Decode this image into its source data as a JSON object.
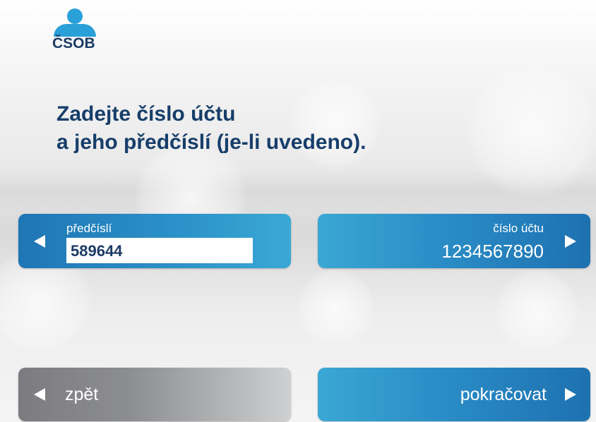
{
  "brand": {
    "logo_text": "ČSOB",
    "logo_color": "#2aa0d8",
    "text_color": "#1c3b64"
  },
  "title": {
    "line1": "Zadejte číslo účtu",
    "line2": "a jeho předčíslí (je-li uvedeno)."
  },
  "prefix_field": {
    "label": "předčíslí",
    "value": "589644",
    "arrow_icon": "triangle-left-icon"
  },
  "account_field": {
    "label": "číslo účtu",
    "value": "1234567890",
    "arrow_icon": "triangle-right-icon"
  },
  "buttons": {
    "back": {
      "label": "zpět",
      "icon": "triangle-left-icon"
    },
    "continue": {
      "label": "pokračovat",
      "icon": "triangle-right-icon"
    }
  },
  "colors": {
    "accent_blue": "#2c92c9",
    "title": "#173e6a",
    "gray_button": "#8c8d90"
  }
}
